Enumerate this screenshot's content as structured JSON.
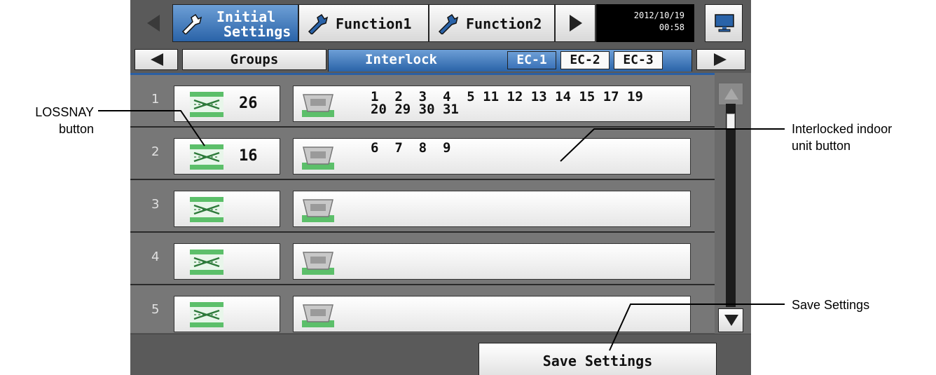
{
  "topbar": {
    "tabs": [
      {
        "label_line1": "Initial",
        "label_line2": "Settings",
        "icon": "wrench-icon",
        "active": true
      },
      {
        "label": "Function1",
        "icon": "wrench-icon",
        "active": false
      },
      {
        "label": "Function2",
        "icon": "wrench-icon",
        "active": false
      }
    ],
    "clock": {
      "date": "2012/10/19",
      "time": "00:58"
    },
    "monitor_icon": "monitor-icon"
  },
  "tabbar": {
    "tabs": [
      {
        "label": "Groups"
      },
      {
        "label": "Interlock"
      }
    ],
    "ec_tabs": [
      {
        "label": "EC-1"
      },
      {
        "label": "EC-2"
      },
      {
        "label": "EC-3"
      }
    ]
  },
  "rows": [
    {
      "number": "1",
      "lossnay": "26",
      "units_line1": "1  2  3  4  5 11 12 13 14 15 17 19",
      "units_line2": "20 29 30 31"
    },
    {
      "number": "2",
      "lossnay": "16",
      "units_line1": "6  7  8  9",
      "units_line2": ""
    },
    {
      "number": "3",
      "lossnay": "",
      "units_line1": "",
      "units_line2": ""
    },
    {
      "number": "4",
      "lossnay": "",
      "units_line1": "",
      "units_line2": ""
    },
    {
      "number": "5",
      "lossnay": "",
      "units_line1": "",
      "units_line2": ""
    }
  ],
  "footer": {
    "save_label": "Save Settings"
  },
  "callouts": {
    "lossnay_line1": "LOSSNAY",
    "lossnay_line2": "button",
    "indoor_line1": "Interlocked indoor",
    "indoor_line2": "unit button",
    "save": "Save Settings"
  },
  "colors": {
    "active_tab": "#2a63a8",
    "background": "#5a5a5a",
    "lossnay_green": "#5cbf6a"
  }
}
